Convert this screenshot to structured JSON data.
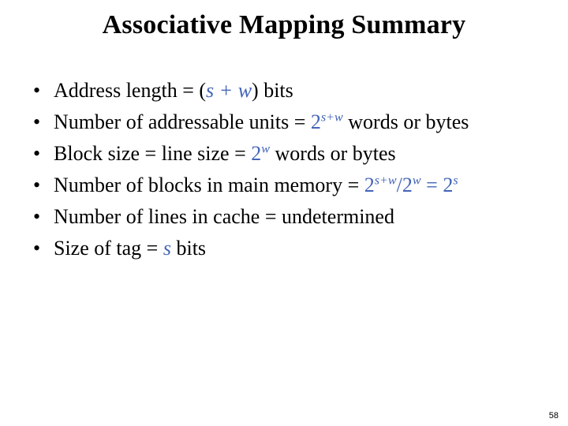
{
  "slide": {
    "title": "Associative Mapping Summary",
    "page_number": "58",
    "colors": {
      "background": "#ffffff",
      "text": "#000000",
      "math_accent": "#4365B8"
    },
    "bullet_marker": "•",
    "bullets": [
      {
        "id": "address-length",
        "segments": [
          {
            "text": "Address length = (",
            "style": "plain"
          },
          {
            "text": "s",
            "style": "math"
          },
          {
            "text": " + ",
            "style": "math"
          },
          {
            "text": "w",
            "style": "math"
          },
          {
            "text": ") bits",
            "style": "plain"
          }
        ],
        "plain_text": "Address length = (s + w) bits"
      },
      {
        "id": "number-of-addressable-units",
        "segments": [
          {
            "text": "Number of addressable units = ",
            "style": "plain"
          },
          {
            "text": "2",
            "style": "math-upright"
          },
          {
            "text": "s+w",
            "style": "superscript-math"
          },
          {
            "text": " words or bytes",
            "style": "plain"
          }
        ],
        "plain_text": "Number of addressable units = 2s+w words or bytes"
      },
      {
        "id": "block-size",
        "segments": [
          {
            "text": "Block size = line size = ",
            "style": "plain"
          },
          {
            "text": "2",
            "style": "math-upright"
          },
          {
            "text": "w",
            "style": "superscript-math"
          },
          {
            "text": " words or bytes",
            "style": "plain"
          }
        ],
        "plain_text": "Block size = line size = 2w words or bytes"
      },
      {
        "id": "number-of-blocks-in-main-memory",
        "segments": [
          {
            "text": "Number of blocks in main memory = ",
            "style": "plain"
          },
          {
            "text": "2",
            "style": "math-upright"
          },
          {
            "text": "s+w",
            "style": "superscript-math"
          },
          {
            "text": "/",
            "style": "math-upright"
          },
          {
            "text": "2",
            "style": "math-upright"
          },
          {
            "text": "w",
            "style": "superscript-math"
          },
          {
            "text": " = ",
            "style": "math-upright"
          },
          {
            "text": "2",
            "style": "math-upright"
          },
          {
            "text": "s",
            "style": "superscript-math"
          }
        ],
        "plain_text": "Number of blocks in main memory = 2s+w/2w = 2s"
      },
      {
        "id": "number-of-lines-in-cache",
        "segments": [
          {
            "text": "Number of lines in cache = undetermined",
            "style": "plain"
          }
        ],
        "plain_text": "Number of lines in cache = undetermined"
      },
      {
        "id": "size-of-tag",
        "segments": [
          {
            "text": "Size of tag = ",
            "style": "plain"
          },
          {
            "text": "s",
            "style": "math"
          },
          {
            "text": " bits",
            "style": "plain"
          }
        ],
        "plain_text": "Size of tag = s bits"
      }
    ]
  }
}
